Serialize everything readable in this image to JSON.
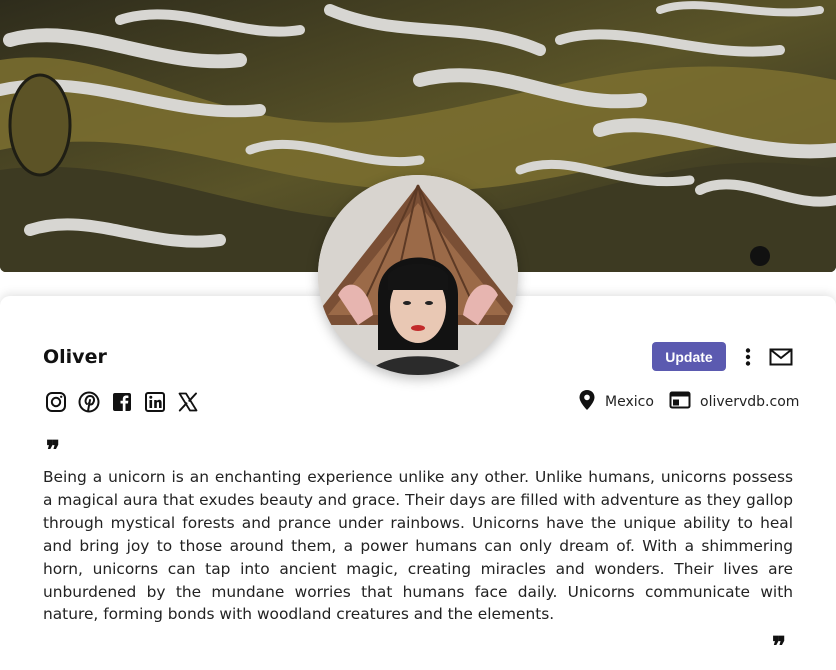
{
  "profile": {
    "name": "Oliver",
    "location": "Mexico",
    "website": "olivervdb.com",
    "bio": "Being a unicorn is an enchanting experience unlike any other. Unlike humans, unicorns possess a magical aura that exudes beauty and grace. Their days are filled with adventure as they gallop through mystical forests and prance under rainbows. Unicorns have the unique ability to heal and bring joy to those around them, a power humans can only dream of. With a shimmering horn, unicorns can tap into ancient magic, creating miracles and wonders. Their lives are unburdened by the mundane worries that humans face daily. Unicorns communicate with nature, forming bonds with woodland creatures and the elements.",
    "quote_open": "❞",
    "quote_close": "❞"
  },
  "actions": {
    "update_label": "Update"
  },
  "icons": {
    "social": [
      "instagram-icon",
      "pinterest-icon",
      "facebook-icon",
      "linkedin-icon",
      "x-icon"
    ],
    "location": "map-pin-icon",
    "website": "browser-window-icon",
    "more": "kebab-menu-icon",
    "mail": "mail-icon"
  },
  "colors": {
    "update_button": "#5b5ab0",
    "text": "#1a1a1a"
  }
}
